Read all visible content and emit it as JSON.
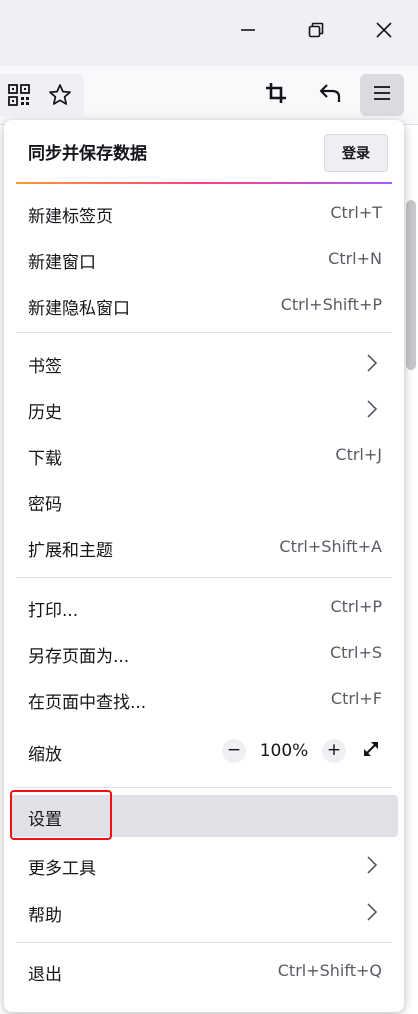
{
  "window": {
    "minimize_icon": "minimize-icon",
    "restore_icon": "restore-icon",
    "close_icon": "close-icon"
  },
  "toolbar": {
    "qr_icon": "qr-code-icon",
    "bookmark_icon": "star-icon",
    "crop_icon": "crop-icon",
    "undo_icon": "undo-icon",
    "menu_icon": "hamburger-menu-icon"
  },
  "menu": {
    "sync": {
      "label": "同步并保存数据",
      "signin": "登录"
    },
    "items": [
      {
        "label": "新建标签页",
        "shortcut": "Ctrl+T"
      },
      {
        "label": "新建窗口",
        "shortcut": "Ctrl+N"
      },
      {
        "label": "新建隐私窗口",
        "shortcut": "Ctrl+Shift+P"
      },
      {
        "label": "书签",
        "submenu": true
      },
      {
        "label": "历史",
        "submenu": true
      },
      {
        "label": "下载",
        "shortcut": "Ctrl+J"
      },
      {
        "label": "密码"
      },
      {
        "label": "扩展和主题",
        "shortcut": "Ctrl+Shift+A"
      },
      {
        "label": "打印...",
        "shortcut": "Ctrl+P"
      },
      {
        "label": "另存页面为...",
        "shortcut": "Ctrl+S"
      },
      {
        "label": "在页面中查找...",
        "shortcut": "Ctrl+F"
      },
      {
        "label": "设置",
        "highlighted": true
      },
      {
        "label": "更多工具",
        "submenu": true
      },
      {
        "label": "帮助",
        "submenu": true
      },
      {
        "label": "退出",
        "shortcut": "Ctrl+Shift+Q"
      }
    ],
    "zoom": {
      "label": "缩放",
      "decrease": "−",
      "value": "100%",
      "increase": "+",
      "fullscreen_icon": "fullscreen-icon"
    }
  },
  "colors": {
    "highlight": "#e0e0e6",
    "focus_outline": "#ee1111",
    "sync_gradient": [
      "#ff9a2e",
      "#ff3d81",
      "#a55cff"
    ]
  }
}
